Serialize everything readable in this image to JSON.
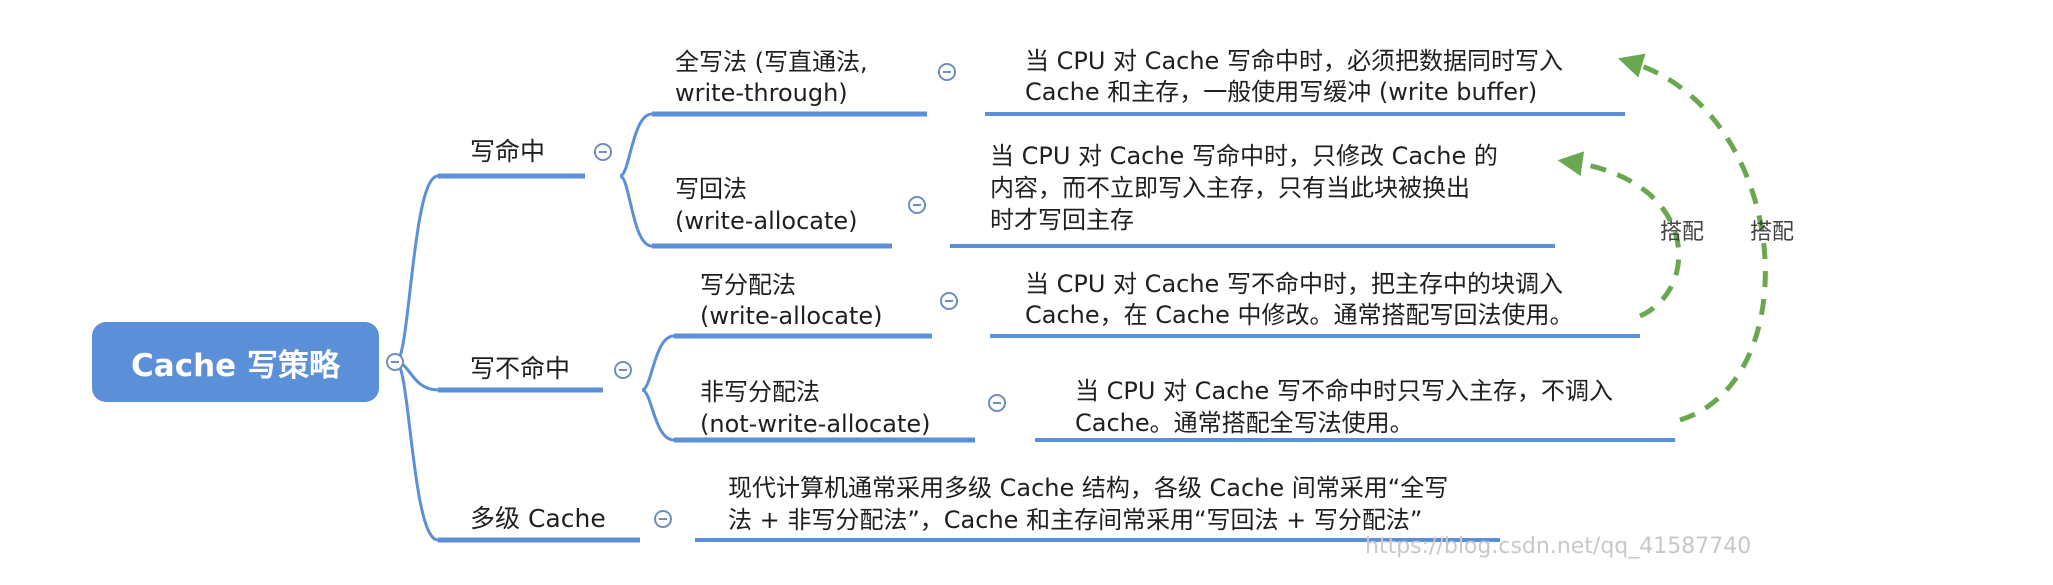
{
  "root": {
    "label": "Cache 写策略"
  },
  "hit": {
    "label": "写命中",
    "write_through": {
      "label_line1": "全写法 (写直通法,",
      "label_line2": "write-through)",
      "desc_line1": "当 CPU 对 Cache 写命中时，必须把数据同时写入",
      "desc_line2": "Cache 和主存，一般使用写缓冲 (write buffer)"
    },
    "write_back": {
      "label_line1": "写回法",
      "label_line2": "(write-allocate)",
      "desc_line1": "当 CPU 对 Cache 写命中时，只修改 Cache 的",
      "desc_line2": "内容，而不立即写入主存，只有当此块被换出",
      "desc_line3": "时才写回主存"
    }
  },
  "miss": {
    "label": "写不命中",
    "write_allocate": {
      "label_line1": "写分配法",
      "label_line2": "(write-allocate)",
      "desc_line1": "当 CPU 对 Cache 写不命中时，把主存中的块调入",
      "desc_line2": "Cache，在 Cache 中修改。通常搭配写回法使用。"
    },
    "not_write_allocate": {
      "label_line1": "非写分配法",
      "label_line2": "(not-write-allocate)",
      "desc_line1": "当 CPU 对 Cache 写不命中时只写入主存，不调入",
      "desc_line2": "Cache。通常搭配全写法使用。"
    }
  },
  "multi": {
    "label": "多级 Cache",
    "desc_line1": "现代计算机通常采用多级 Cache 结构，各级 Cache 间常采用“全写",
    "desc_line2": "法 + 非写分配法”，Cache 和主存间常采用“写回法 + 写分配法”"
  },
  "pairing": {
    "inner_label": "搭配",
    "outer_label": "搭配"
  },
  "watermark": "https://blog.csdn.net/qq_41587740",
  "colors": {
    "root_fill": "#5b8fd7",
    "branch_line": "#5b8fd7",
    "pairing_arrow": "#6aa84f",
    "watermark": "#c8c8c8"
  },
  "icons": {
    "collapse": "circle-minus-icon"
  }
}
